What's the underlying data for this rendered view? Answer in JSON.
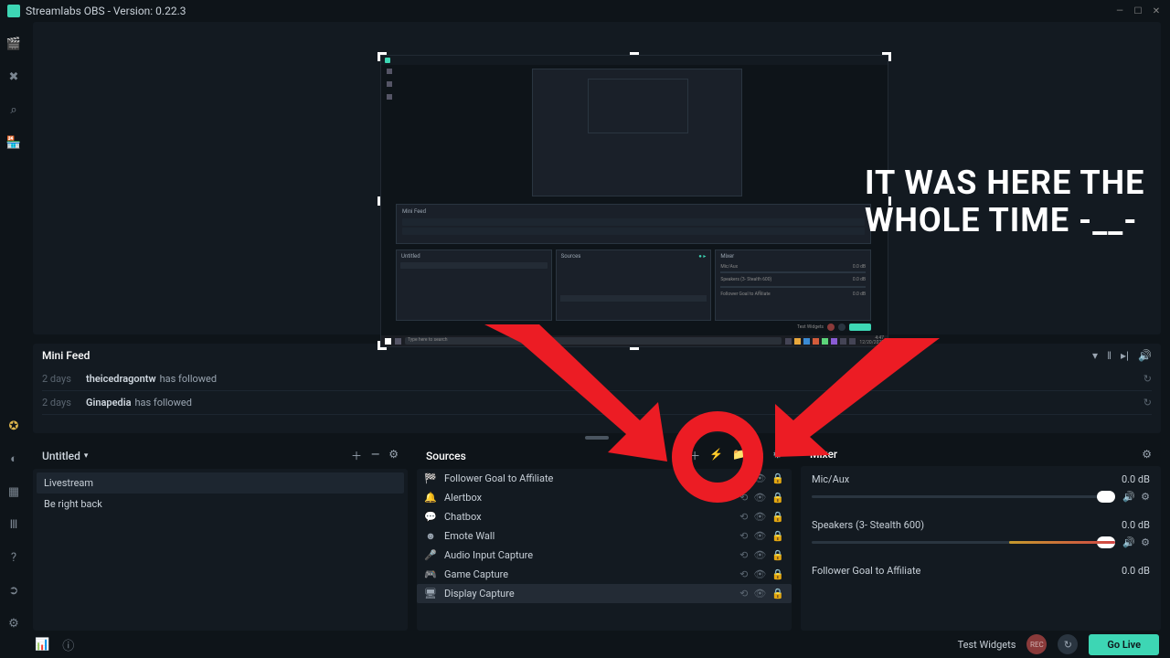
{
  "titlebar": {
    "title": "Streamlabs OBS - Version: 0.22.3"
  },
  "annotation": {
    "text": "IT WAS HERE THE WHOLE TIME -__-"
  },
  "minifeed": {
    "title": "Mini Feed",
    "items": [
      {
        "time": "2 days",
        "user": "theicedragontw",
        "action": "has followed"
      },
      {
        "time": "2 days",
        "user": "Ginapedia",
        "action": "has followed"
      }
    ]
  },
  "scenes": {
    "collection_label": "Untitled",
    "items": [
      {
        "name": "Livestream",
        "selected": true
      },
      {
        "name": "Be right back",
        "selected": false
      }
    ]
  },
  "sources": {
    "title": "Sources",
    "items": [
      {
        "name": "Follower Goal to Affiliate",
        "icon": "goal",
        "selected": false
      },
      {
        "name": "Alertbox",
        "icon": "bell",
        "selected": false
      },
      {
        "name": "Chatbox",
        "icon": "chat",
        "selected": false
      },
      {
        "name": "Emote Wall",
        "icon": "smile",
        "selected": false
      },
      {
        "name": "Audio Input Capture",
        "icon": "mic",
        "selected": false
      },
      {
        "name": "Game Capture",
        "icon": "gamepad",
        "selected": false
      },
      {
        "name": "Display Capture",
        "icon": "monitor",
        "selected": true
      }
    ]
  },
  "mixer": {
    "title": "Mixer",
    "channels": [
      {
        "name": "Mic/Aux",
        "level": "0.0 dB",
        "warn": false
      },
      {
        "name": "Speakers (3- Stealth 600)",
        "level": "0.0 dB",
        "warn": true
      },
      {
        "name": "Follower Goal to Affiliate",
        "level": "0.0 dB",
        "warn": false,
        "no_slider": true
      }
    ]
  },
  "bottombar": {
    "test_widgets": "Test Widgets",
    "rec_label": "REC",
    "go_live": "Go Live"
  },
  "source_action_icons": {
    "link": "⟲",
    "visible": "👁",
    "lock": "🔒"
  },
  "icons": {
    "goal": "🏁",
    "bell": "🔔",
    "chat": "💬",
    "smile": "☻",
    "mic": "🎤",
    "gamepad": "🎮",
    "monitor": "🖥"
  }
}
